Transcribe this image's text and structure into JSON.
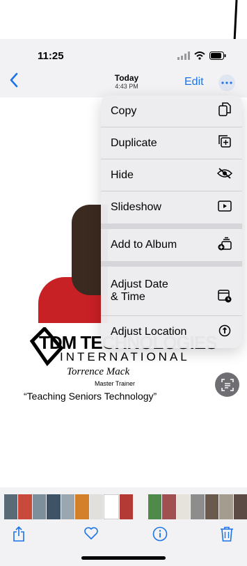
{
  "status": {
    "time": "11:25"
  },
  "nav": {
    "back_icon": "chevron-left-icon",
    "title": "Today",
    "subtitle": "4:43 PM",
    "edit_label": "Edit",
    "more_icon": "ellipsis-circle-icon"
  },
  "menu": {
    "items": [
      {
        "label": "Copy",
        "icon": "copy-icon"
      },
      {
        "label": "Duplicate",
        "icon": "duplicate-icon"
      },
      {
        "label": "Hide",
        "icon": "eye-slash-icon"
      },
      {
        "label": "Slideshow",
        "icon": "play-rectangle-icon"
      },
      {
        "label": "Add to Album",
        "icon": "add-album-icon"
      },
      {
        "label": "Adjust Date\n& Time",
        "icon": "calendar-clock-icon"
      },
      {
        "label": "Adjust Location",
        "icon": "location-info-icon"
      }
    ]
  },
  "photo": {
    "logo_main": "TDM TECHNOLOGIES",
    "logo_sub": "INTERNATIONAL",
    "name": "Torrence Mack",
    "role": "Master Trainer",
    "tagline": "“Teaching Seniors Technology”"
  },
  "toolbar": {
    "share_icon": "share-icon",
    "favorite_icon": "heart-icon",
    "info_icon": "info-icon",
    "delete_icon": "trash-icon"
  },
  "colors": {
    "accent": "#1a73e8",
    "menu_bg": "#ececee"
  }
}
